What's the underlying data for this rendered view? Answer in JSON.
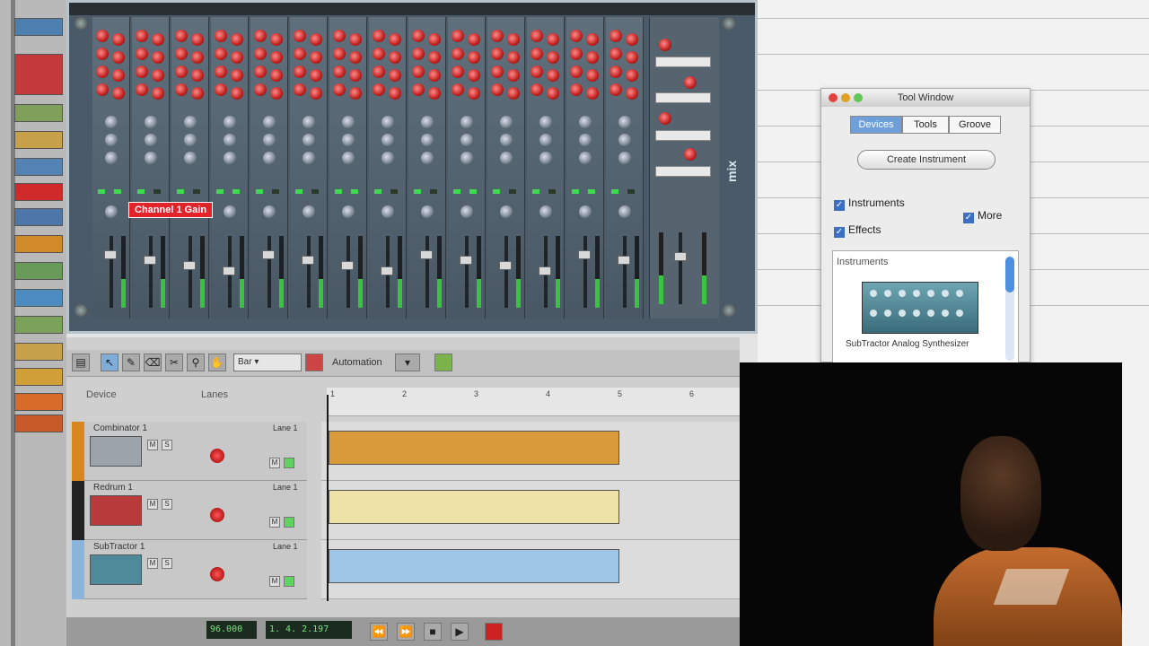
{
  "mixer": {
    "channel_count": 14,
    "tooltip": "Channel 1 Gain",
    "logo": "mix"
  },
  "sequencer": {
    "automation_label": "Automation",
    "col_device": "Device",
    "col_lanes": "Lanes",
    "ruler_marks": [
      "1",
      "2",
      "3",
      "4",
      "5",
      "6"
    ],
    "tracks": [
      {
        "name": "Combinator 1",
        "lane": "Lane 1",
        "clip_color": "#d99a3a",
        "track_color": "#d9861e"
      },
      {
        "name": "Redrum 1",
        "lane": "Lane 1",
        "clip_color": "#efe2a6",
        "track_color": "#222222"
      },
      {
        "name": "SubTractor 1",
        "lane": "Lane 1",
        "clip_color": "#9fc6e6",
        "track_color": "#8ab4da"
      }
    ],
    "transport": {
      "tempo": "96.000",
      "position": "1. 4. 2.197"
    }
  },
  "tool_window": {
    "title": "Tool Window",
    "tabs": [
      "Devices",
      "Tools",
      "Groove"
    ],
    "active_tab": "Devices",
    "create_button": "Create Instrument",
    "check_instruments": "Instruments",
    "check_effects": "Effects",
    "check_more": "More",
    "browser_header": "Instruments",
    "browser_item": "SubTractor Analog Synthesizer"
  },
  "colors": {
    "mixer_bg": "#4a5a68",
    "accent_blue": "#6e9fd8",
    "tooltip_red": "#e0242a"
  }
}
